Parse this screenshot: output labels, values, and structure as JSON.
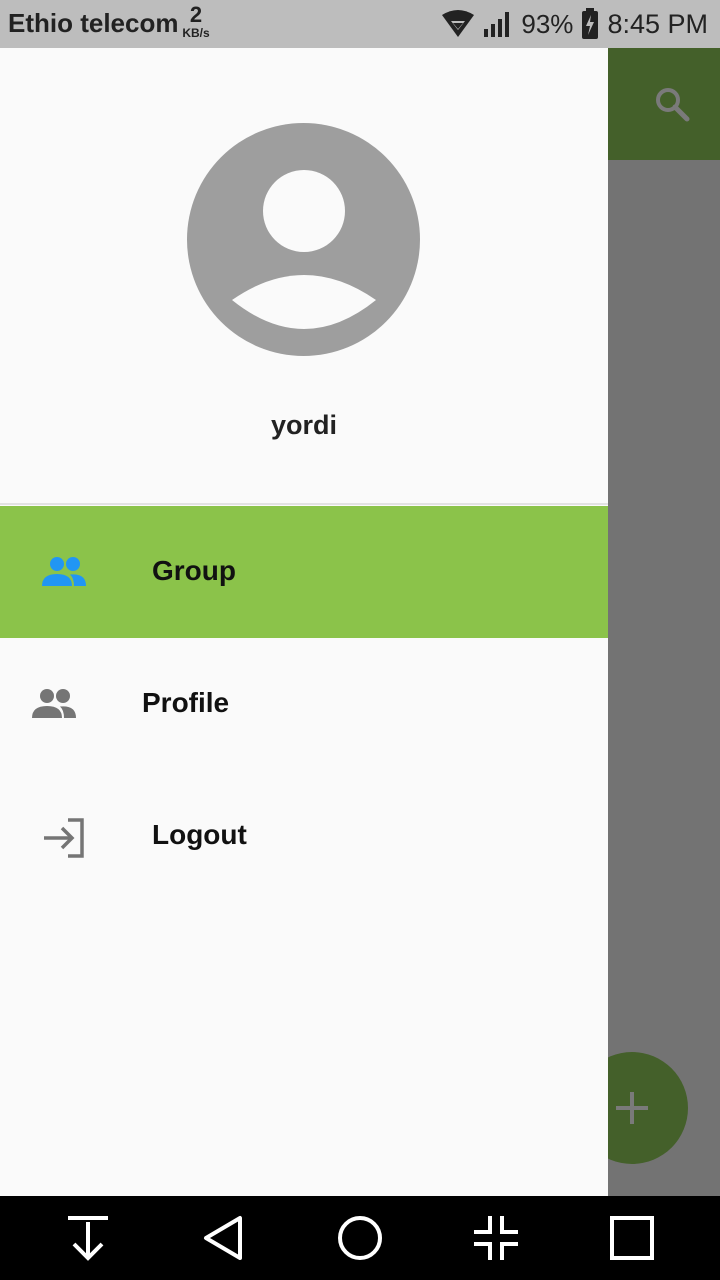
{
  "status_bar": {
    "carrier": "Ethio telecom",
    "speed_value": "2",
    "speed_unit": "KB/s",
    "battery_percent": "93%",
    "time": "8:45 PM"
  },
  "drawer": {
    "username": "yordi",
    "menu": [
      {
        "label": "Group",
        "icon": "group-icon",
        "selected": true
      },
      {
        "label": "Profile",
        "icon": "group-icon",
        "selected": false
      },
      {
        "label": "Logout",
        "icon": "logout-icon",
        "selected": false
      }
    ]
  },
  "background_app": {
    "toolbar_action": "search-icon",
    "fab_icon": "add-icon"
  },
  "nav_bar": {
    "buttons": [
      "notification-pull-icon",
      "back-icon",
      "home-icon",
      "minimize-icon",
      "recents-icon"
    ]
  },
  "colors": {
    "status_bar": "#bdbdbd",
    "drawer_bg": "#fafafa",
    "selected_item": "#8bc34a",
    "selected_icon": "#2196f3",
    "default_icon": "#757575",
    "scrim_app_primary": "#44602a",
    "scrim": "#737373"
  }
}
